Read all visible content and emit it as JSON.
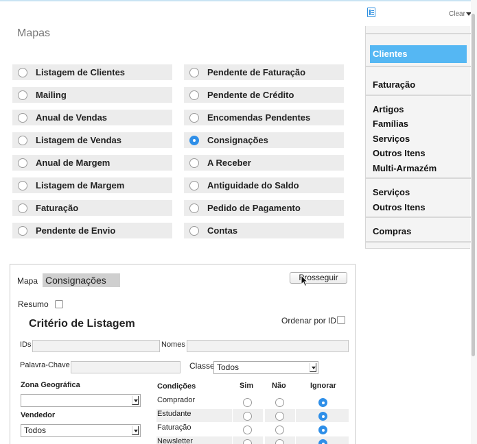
{
  "page": {
    "title": "Mapas"
  },
  "maps": {
    "left": [
      {
        "label": "Listagem de Clientes",
        "selected": false
      },
      {
        "label": "Mailing",
        "selected": false
      },
      {
        "label": "Anual de Vendas",
        "selected": false
      },
      {
        "label": "Listagem de Vendas",
        "selected": false
      },
      {
        "label": "Anual de Margem",
        "selected": false
      },
      {
        "label": "Listagem de Margem",
        "selected": false
      },
      {
        "label": "Faturação",
        "selected": false
      },
      {
        "label": "Pendente de Envio",
        "selected": false
      }
    ],
    "right": [
      {
        "label": "Pendente de Faturação",
        "selected": false
      },
      {
        "label": "Pendente de Crédito",
        "selected": false
      },
      {
        "label": "Encomendas Pendentes",
        "selected": false
      },
      {
        "label": "Consignações",
        "selected": true
      },
      {
        "label": "A Receber",
        "selected": false
      },
      {
        "label": "Antiguidade do Saldo",
        "selected": false
      },
      {
        "label": "Pedido de Pagamento",
        "selected": false
      },
      {
        "label": "Contas",
        "selected": false
      }
    ]
  },
  "form": {
    "mapa_label": "Mapa",
    "mapa_value": "Consignações",
    "proceed_label": "Prosseguir",
    "resumo_label": "Resumo",
    "resumo_checked": false,
    "section_title": "Critério de Listagem",
    "order_by_id_label": "Ordenar por ID",
    "order_by_id_checked": false,
    "ids_label": "IDs",
    "ids_value": "",
    "names_label": "Nomes",
    "names_value": "",
    "keyword_label": "Palavra-Chave",
    "keyword_value": "",
    "class_label": "Classe",
    "class_value": "Todos",
    "zone_label": "Zona Geográfica",
    "zone_value": "",
    "seller_label": "Vendedor",
    "seller_value": "Todos",
    "conditions": {
      "header_label": "Condições",
      "yes_label": "Sim",
      "no_label": "Não",
      "ignore_label": "Ignorar",
      "rows": [
        {
          "label": "Comprador",
          "value": "ignorar"
        },
        {
          "label": "Estudante",
          "value": "ignorar"
        },
        {
          "label": "Faturação",
          "value": "ignorar"
        },
        {
          "label": "Newsletter",
          "value": "ignorar"
        }
      ]
    }
  },
  "sidebar": {
    "clear_label": "Clear",
    "groups": [
      [
        "Clientes"
      ],
      [
        "Faturação"
      ],
      [
        "Artigos",
        "Famílias",
        "Serviços",
        "Outros Itens",
        "Multi-Armazém"
      ],
      [
        "Serviços",
        "Outros Itens"
      ],
      [
        "Compras"
      ]
    ],
    "active": "Clientes"
  },
  "colors": {
    "accent": "#2f8fe8",
    "sidebar_active": "#55b7f3",
    "item_background": "#ececec"
  }
}
